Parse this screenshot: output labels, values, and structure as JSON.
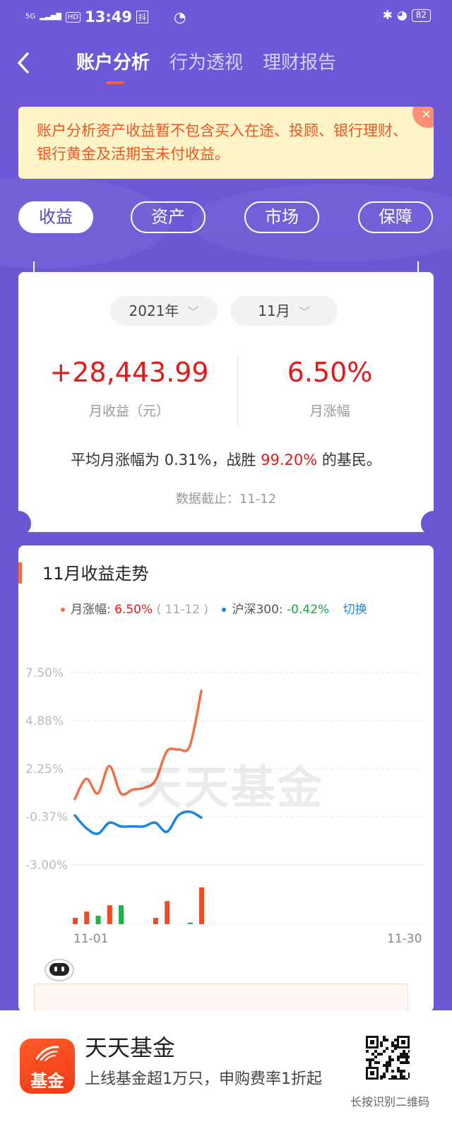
{
  "status_bar": {
    "network": "5G",
    "hd": "HD",
    "time": "13:49",
    "extra": "抖",
    "battery": "82"
  },
  "nav": {
    "tabs": [
      {
        "label": "账户分析",
        "active": true
      },
      {
        "label": "行为透视",
        "active": false
      },
      {
        "label": "理财报告",
        "active": false
      }
    ]
  },
  "notice": {
    "text": "账户分析资产收益暂不包含买入在途、投顾、银行理财、银行黄金及活期宝未付收益。",
    "close": "×"
  },
  "segments": [
    {
      "label": "收益",
      "active": true
    },
    {
      "label": "资产",
      "active": false
    },
    {
      "label": "市场",
      "active": false
    },
    {
      "label": "保障",
      "active": false
    }
  ],
  "summary": {
    "year": "2021年",
    "month": "11月",
    "monthly_profit": "+28,443.99",
    "monthly_profit_label": "月收益（元）",
    "monthly_change": "6.50%",
    "monthly_change_label": "月涨幅",
    "avg_prefix": "平均月涨幅为",
    "avg_value": "0.31%",
    "avg_mid": "，战胜",
    "beat_value": "99.20%",
    "avg_suffix": "的基民。",
    "as_of": "数据截止：11-12"
  },
  "trend": {
    "title": "11月收益走势",
    "legend_a_label": "月涨幅:",
    "legend_a_value": "6.50%",
    "legend_a_date": "( 11-12 )",
    "legend_b_label": "沪深300:",
    "legend_b_value": "-0.42%",
    "switch_label": "切换",
    "watermark": "天天基金"
  },
  "chart_data": {
    "type": "line",
    "y_ticks": [
      "7.50%",
      "4.88%",
      "2.25%",
      "-0.37%",
      "-3.00%"
    ],
    "ylim": [
      -3.0,
      7.5
    ],
    "x_start_label": "11-01",
    "x_end_label": "11-30",
    "x_range": [
      1,
      30
    ],
    "series": [
      {
        "name": "月涨幅",
        "color": "#f07048",
        "x": [
          1,
          2,
          3,
          4,
          5,
          6,
          7,
          8,
          9,
          10,
          11,
          12
        ],
        "values": [
          0.6,
          1.7,
          0.9,
          2.4,
          0.9,
          1.1,
          1.2,
          1.6,
          3.2,
          3.3,
          3.5,
          6.5
        ]
      },
      {
        "name": "沪深300",
        "color": "#1a84de",
        "x": [
          1,
          2,
          3,
          4,
          5,
          6,
          7,
          8,
          9,
          10,
          11,
          12
        ],
        "values": [
          -0.3,
          -1.0,
          -1.3,
          -0.7,
          -0.9,
          -0.9,
          -0.9,
          -0.7,
          -1.2,
          -0.3,
          -0.1,
          -0.42
        ]
      }
    ],
    "daily_bars": {
      "x": [
        1,
        2,
        3,
        4,
        5,
        8,
        9,
        11,
        12
      ],
      "values": [
        0.6,
        1.2,
        -0.8,
        1.8,
        -1.8,
        0.6,
        2.2,
        -0.15,
        3.5
      ],
      "up_color": "#f04a20",
      "down_color": "#22b04c"
    }
  },
  "footer": {
    "logo_text": "基金",
    "title": "天天基金",
    "desc": "上线基金超1万只，申购费率1折起",
    "qr_caption": "长按识别二维码"
  }
}
